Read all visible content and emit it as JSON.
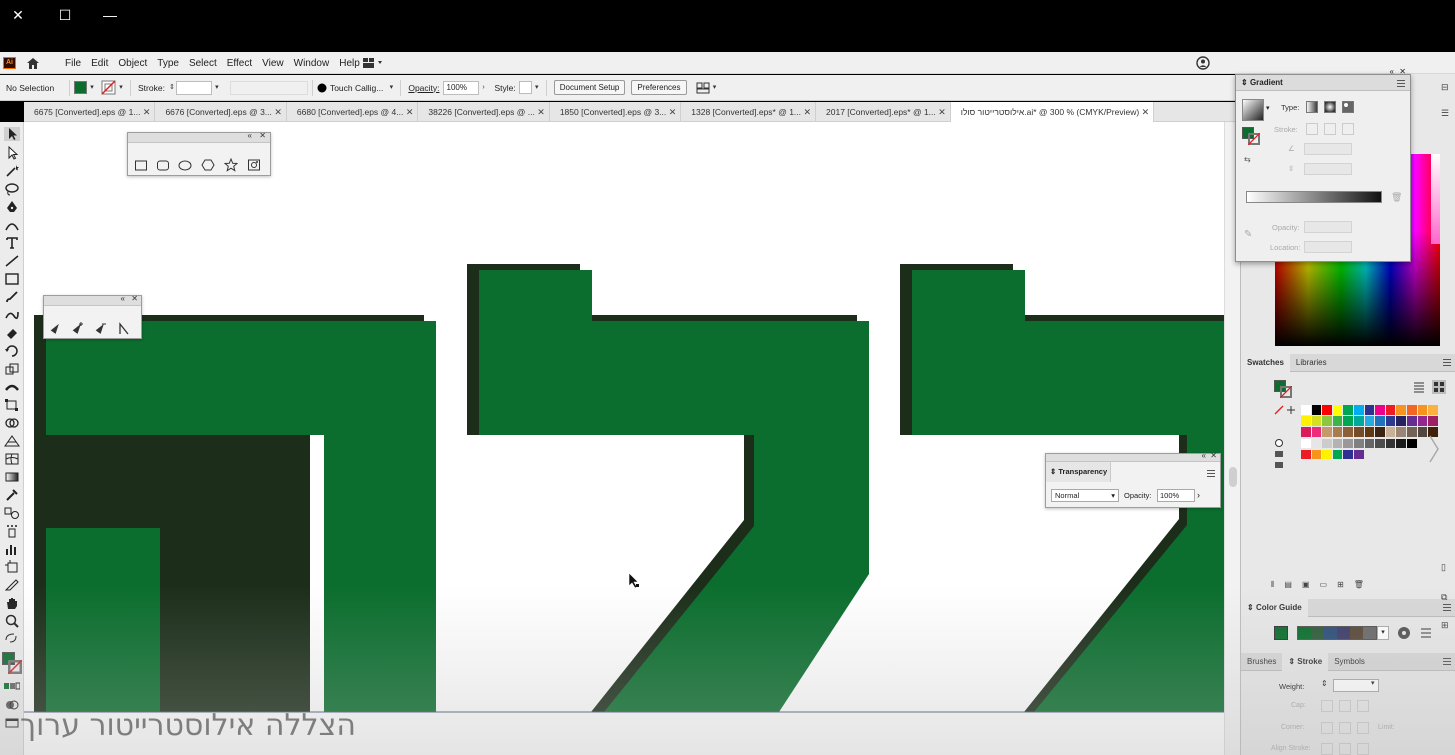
{
  "window": {
    "controls": [
      "close-icon",
      "maximize-icon",
      "minimize-icon"
    ]
  },
  "menubar": {
    "app_logo": "Ai",
    "items": [
      "File",
      "Edit",
      "Object",
      "Type",
      "Select",
      "Effect",
      "View",
      "Window",
      "Help"
    ]
  },
  "control_bar": {
    "selection_status": "No Selection",
    "fill_color": "#0b6e2e",
    "stroke_label": "Stroke:",
    "brush_name": "Touch Callig...",
    "opacity_label": "Opacity:",
    "opacity_value": "100%",
    "style_label": "Style:",
    "document_setup_label": "Document Setup",
    "preferences_label": "Preferences"
  },
  "tabs": [
    {
      "label": "6675 [Converted].eps @ 1...",
      "active": false
    },
    {
      "label": "6676 [Converted].eps @ 3...",
      "active": false
    },
    {
      "label": "6680 [Converted].eps @ 4...",
      "active": false
    },
    {
      "label": "38226 [Converted].eps @ ...",
      "active": false
    },
    {
      "label": "1850 [Converted].eps @ 3...",
      "active": false
    },
    {
      "label": "1328 [Converted].eps* @ 1...",
      "active": false
    },
    {
      "label": "2017 [Converted].eps* @ 1...",
      "active": false
    },
    {
      "label": "אילוסטרייטור סולו.ai* @ 300 % (CMYK/Preview)",
      "active": true
    }
  ],
  "canvas": {
    "letter_fill": "#0b6e2e",
    "shadow_fill": "#1c2e1a"
  },
  "transparency_panel": {
    "title": "Transparency",
    "blend_mode": "Normal",
    "opacity_label": "Opacity:",
    "opacity_value": "100%"
  },
  "gradient_panel": {
    "title": "Gradient",
    "type_label": "Type:",
    "stroke_label": "Stroke:",
    "opacity_label": "Opacity:",
    "location_label": "Location:"
  },
  "swatches_panel": {
    "tabs": [
      "Swatches",
      "Libraries"
    ],
    "rows": [
      [
        "#ffffff",
        "#000000",
        "#ff0000",
        "#ffff00",
        "#00a651",
        "#00aeef",
        "#2e3192",
        "#ec008c",
        "#ed1c24",
        "#f7941d",
        "#f26522",
        "#f7941d",
        "#fbb040"
      ],
      [
        "#fff200",
        "#d7df23",
        "#8dc63f",
        "#39b54a",
        "#00a651",
        "#00a99d",
        "#27aae1",
        "#1c75bc",
        "#2b3990",
        "#262262",
        "#662d91",
        "#92278f",
        "#9e1f63"
      ],
      [
        "#da1c5c",
        "#ee2a7b",
        "#c49a6c",
        "#a97c50",
        "#8b5e3c",
        "#754c29",
        "#603913",
        "#3c2415",
        "#c7b299",
        "#998675",
        "#736357",
        "#534741",
        "#42210b"
      ],
      [
        "#ffffff",
        "#e6e6e6",
        "#cccccc",
        "#b3b3b3",
        "#999999",
        "#808080",
        "#666666",
        "#4d4d4d",
        "#333333",
        "#1a1a1a",
        "#000000"
      ],
      [
        "#ed1c24",
        "#f7941d",
        "#fff200",
        "#00a651",
        "#2e3192",
        "#662d91"
      ]
    ]
  },
  "color_guide_panel": {
    "title": "Color Guide",
    "harmony": [
      "#0b6e2e",
      "#2e5d3a",
      "#2e4f7a",
      "#3d3d6b",
      "#5a4a3a",
      "#6b6b6b"
    ]
  },
  "stroke_panel": {
    "tabs": [
      "Brushes",
      "Stroke",
      "Symbols"
    ],
    "weight_label": "Weight:",
    "cap_label": "Cap:",
    "corner_label": "Corner:",
    "limit_label": "Limit:",
    "align_label": "Align Stroke:"
  },
  "watermark": {
    "text": "הצללה אילוסטרייטור ערוך"
  }
}
